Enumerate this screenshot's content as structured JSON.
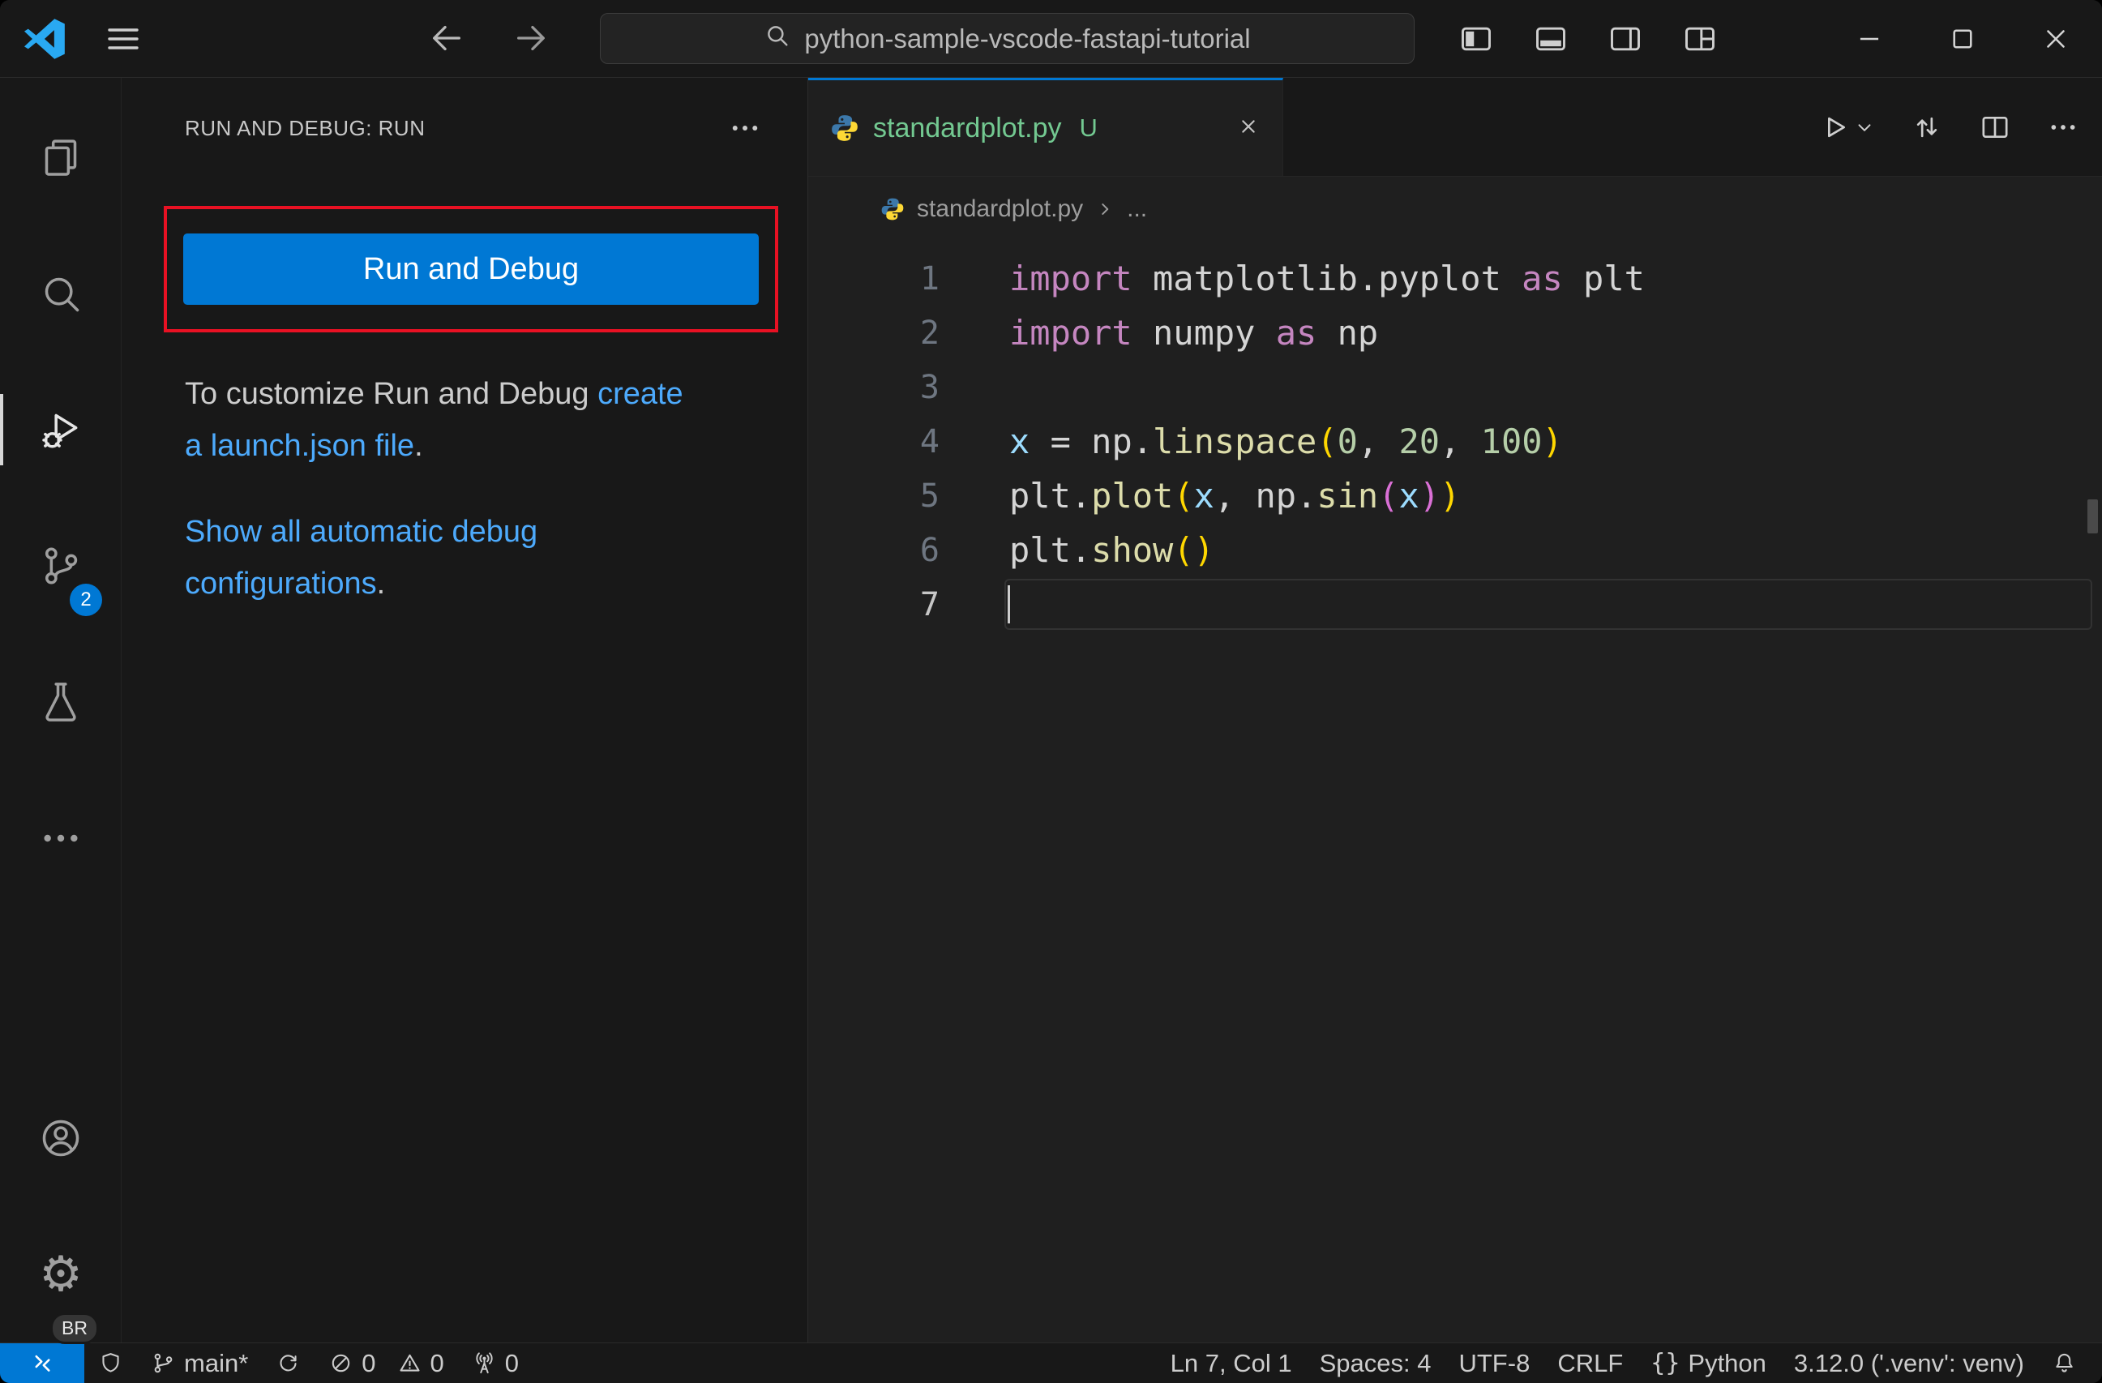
{
  "colors": {
    "accent": "#0078d4",
    "link": "#4daafc",
    "annotation_red": "#e81123",
    "untracked_green": "#73C991",
    "badge": "#0078d4"
  },
  "titlebar": {
    "search_text": "python-sample-vscode-fastapi-tutorial"
  },
  "activity_bar": {
    "source_control_badge": "2",
    "profile_badge": "BR"
  },
  "sidebar": {
    "header_title": "RUN AND DEBUG: RUN",
    "run_button_label": "Run and Debug",
    "customize_prefix": "To customize Run and Debug",
    "launch_link": "create a launch.json file",
    "launch_suffix": ".",
    "configs_link": "Show all automatic debug configurations",
    "configs_suffix": "."
  },
  "editor": {
    "tab": {
      "filename": "standardplot.py",
      "git_status": "U"
    },
    "breadcrumb": {
      "filename": "standardplot.py",
      "ellipsis": "..."
    },
    "code": {
      "active_line": 7,
      "colors": {
        "kw": "#C586C0",
        "mod": "#D4D4D4",
        "var": "#9CDCFE",
        "fn": "#DCDCAA",
        "num": "#B5CEA8",
        "b1": "#FFD700",
        "b2": "#DA70D6",
        "txt": "#D4D4D4"
      },
      "lines": [
        [
          [
            "import ",
            "kw"
          ],
          [
            "matplotlib.pyplot ",
            "mod"
          ],
          [
            "as ",
            "kw"
          ],
          [
            "plt",
            "mod"
          ]
        ],
        [
          [
            "import ",
            "kw"
          ],
          [
            "numpy ",
            "mod"
          ],
          [
            "as ",
            "kw"
          ],
          [
            "np",
            "mod"
          ]
        ],
        [],
        [
          [
            "x ",
            "var"
          ],
          [
            "= ",
            "txt"
          ],
          [
            "np",
            "mod"
          ],
          [
            ".",
            "txt"
          ],
          [
            "linspace",
            "fn"
          ],
          [
            "(",
            "b1"
          ],
          [
            "0",
            "num"
          ],
          [
            ", ",
            "txt"
          ],
          [
            "20",
            "num"
          ],
          [
            ", ",
            "txt"
          ],
          [
            "100",
            "num"
          ],
          [
            ")",
            "b1"
          ]
        ],
        [
          [
            "plt",
            "mod"
          ],
          [
            ".",
            "txt"
          ],
          [
            "plot",
            "fn"
          ],
          [
            "(",
            "b1"
          ],
          [
            "x",
            "var"
          ],
          [
            ", ",
            "txt"
          ],
          [
            "np",
            "mod"
          ],
          [
            ".",
            "txt"
          ],
          [
            "sin",
            "fn"
          ],
          [
            "(",
            "b2"
          ],
          [
            "x",
            "var"
          ],
          [
            ")",
            "b2"
          ],
          [
            ")",
            "b1"
          ]
        ],
        [
          [
            "plt",
            "mod"
          ],
          [
            ".",
            "txt"
          ],
          [
            "show",
            "fn"
          ],
          [
            "(",
            "b1"
          ],
          [
            ")",
            "b1"
          ]
        ],
        []
      ]
    }
  },
  "statusbar": {
    "branch": "main*",
    "errors": "0",
    "warnings": "0",
    "ports": "0",
    "line_col": "Ln 7, Col 1",
    "indentation": "Spaces: 4",
    "encoding": "UTF-8",
    "eol": "CRLF",
    "braces_icon": "{}",
    "language": "Python",
    "interpreter": "3.12.0 ('.venv': venv)"
  }
}
